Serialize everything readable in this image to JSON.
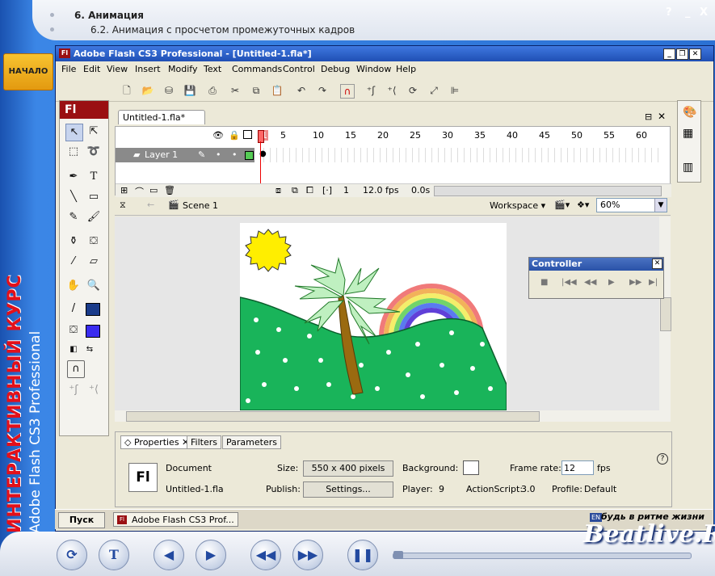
{
  "course": {
    "topic": "6. Анимация",
    "subtopic": "6.2. Анимация с просчетом промежуточных кадров",
    "help": "?",
    "minimize": "_",
    "close": "X",
    "start_label": "НАЧАЛО",
    "vertical_title": "ИНТЕРАКТИВНЫЙ КУРС",
    "vertical_subtitle": "Adobe Flash CS3 Professional",
    "watermark": "Beatlive.Ru"
  },
  "flash": {
    "title": "Adobe Flash CS3 Professional - [Untitled-1.fla*]",
    "logo": "Fl",
    "menu": [
      "File",
      "Edit",
      "View",
      "Insert",
      "Modify",
      "Text",
      "Commands",
      "Control",
      "Debug",
      "Window",
      "Help"
    ],
    "doc_tab": "Untitled-1.fla*",
    "layer_name": "Layer 1",
    "frame_numbers": [
      "1",
      "5",
      "10",
      "15",
      "20",
      "25",
      "30",
      "35",
      "40",
      "45",
      "50",
      "55",
      "60"
    ],
    "current_frame": "1",
    "fps": "12.0 fps",
    "time": "0.0s",
    "scene": "Scene 1",
    "workspace": "Workspace",
    "zoom": "60%",
    "controller_title": "Controller",
    "tools_header": "Fl"
  },
  "properties": {
    "tabs": [
      "Properties",
      "Filters",
      "Parameters"
    ],
    "doc_icon": "Fl",
    "document_label": "Document",
    "document_name": "Untitled-1.fla",
    "size_label": "Size:",
    "size_value": "550 x 400 pixels",
    "publish_label": "Publish:",
    "settings_button": "Settings...",
    "background_label": "Background:",
    "player_label": "Player:",
    "player_value": "9",
    "actionscript_label": "ActionScript:",
    "actionscript_value": "3.0",
    "framerate_label": "Frame rate:",
    "framerate_value": "12",
    "fps_unit": "fps",
    "profile_label": "Profile:",
    "profile_value": "Default",
    "help_icon": "?"
  },
  "taskbar": {
    "start": "Пуск",
    "task": "Adobe Flash CS3 Prof...",
    "tray": "будь в ритме жизни",
    "lang": "EN"
  },
  "colors": {
    "accent": "#1f63c8",
    "flash_red": "#9a0f12",
    "hill_green": "#19b45a",
    "sun_yellow": "#ffee00",
    "trunk": "#9a6a10"
  }
}
